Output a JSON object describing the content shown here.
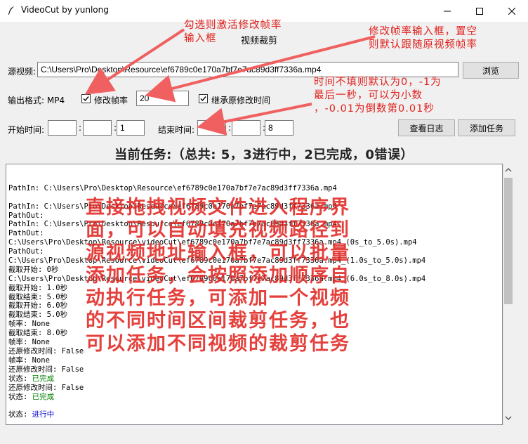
{
  "window": {
    "title": "VideoCut  by yunlong",
    "header": "视频裁剪"
  },
  "form": {
    "source_label": "源视频:",
    "source_path": "C:\\Users\\Pro\\Desktop\\Resource\\ef6789c0e170a7bf7e7ac89d3ff7336a.mp4",
    "browse_label": "浏览",
    "format_label": "输出格式: MP4",
    "modify_fps_label": "修改帧率",
    "modify_fps_checked": true,
    "fps_value": "20",
    "inherit_time_label": "继承原修改时间",
    "inherit_time_checked": true,
    "start_label": "开始时间:",
    "start_h": "",
    "start_m": "",
    "start_s": "1",
    "end_label": "结束时间:",
    "end_h": "",
    "end_m": "",
    "end_s": "8",
    "colon": ":",
    "view_log_label": "查看日志",
    "add_task_label": "添加任务"
  },
  "task_summary": "当前任务:（总共: 5，3进行中，2已完成，0错误）",
  "tasks": [
    {
      "path_in": "PathIn: C:\\Users\\Pro\\Desktop\\Resource\\ef6789c0e170a7bf7e7ac89d3ff7336a.mp4",
      "path_out_label": "PathOut:",
      "path_out": "C:\\Users\\Pro\\Desktop\\Resource\\videoCut\\ef6789c0e170a7bf7e7ac89d3ff7336a.mp4_(0s_to_5.0s).mp4",
      "start": "截取开始: 0秒",
      "end": "截取结束: 5.0秒",
      "fps": "帧率: None",
      "restore": "还原修改时间: False",
      "status_label": "状态: ",
      "status": "已完成",
      "status_color": "#008000"
    },
    {
      "path_in": "PathIn: C:\\Users\\Pro\\Desktop\\Resource\\ef6789c0e170a7bf7e7ac89d3ff7336a.mp4",
      "path_out_label": "PathOut:",
      "path_out": "C:\\Users\\Pro\\Desktop\\Resource\\videoCut\\ef6789c0e170a7bf7e7ac89d3ff7336a.mp4_(1.0s_to_5.0s).mp4",
      "start": "截取开始: 1.0秒",
      "end": "截取结束: 5.0秒",
      "fps": "帧率: None",
      "restore": "还原修改时间: False",
      "status_label": "状态: ",
      "status": "已完成",
      "status_color": "#008000"
    },
    {
      "path_in": "PathIn: C:\\Users\\Pro\\Desktop\\Resource\\ef6789c0e170a7bf7e7ac89d3ff7336a.mp4",
      "path_out_label": "PathOut:",
      "path_out": "C:\\Users\\Pro\\Desktop\\Resource\\videoCut\\ef6789c0e170a7bf7e7ac89d3ff7336a.mp4_(6.0s_to_8.0s).mp4",
      "start": "截取开始: 6.0秒",
      "end": "截取结束: 8.0秒",
      "fps": "帧率: None",
      "restore": "还原修改时间: False",
      "status_label": "状态: ",
      "status": "进行中",
      "status_color": "#0000cc"
    }
  ],
  "annotations": {
    "note1_line1": "勾选则激活修改帧率",
    "note1_line2": "输入框",
    "note2_line1": "修改帧率输入框，置空",
    "note2_line2": "则默认跟随原视频帧率",
    "note3_line1": "时间不填则默认为0，-1为",
    "note3_line2": "最后一秒，可以为小数",
    "note3_line3": "，-0.01为倒数第0.01秒",
    "big_lines": [
      "直接拖拽视频文件进入程序界",
      "面，可以自动填充视频路径到",
      "源视频地址输入框，可以批量",
      "添加任务，会按照添加顺序自",
      "动执行任务，可添加一个视频",
      "的不同时间区间裁剪任务，也",
      "可以添加不同视频的裁剪任务"
    ],
    "color": "#e0201c"
  },
  "icons": {
    "app": "feather-icon",
    "minimize": "minimize-icon",
    "maximize": "maximize-icon",
    "close": "close-icon"
  }
}
